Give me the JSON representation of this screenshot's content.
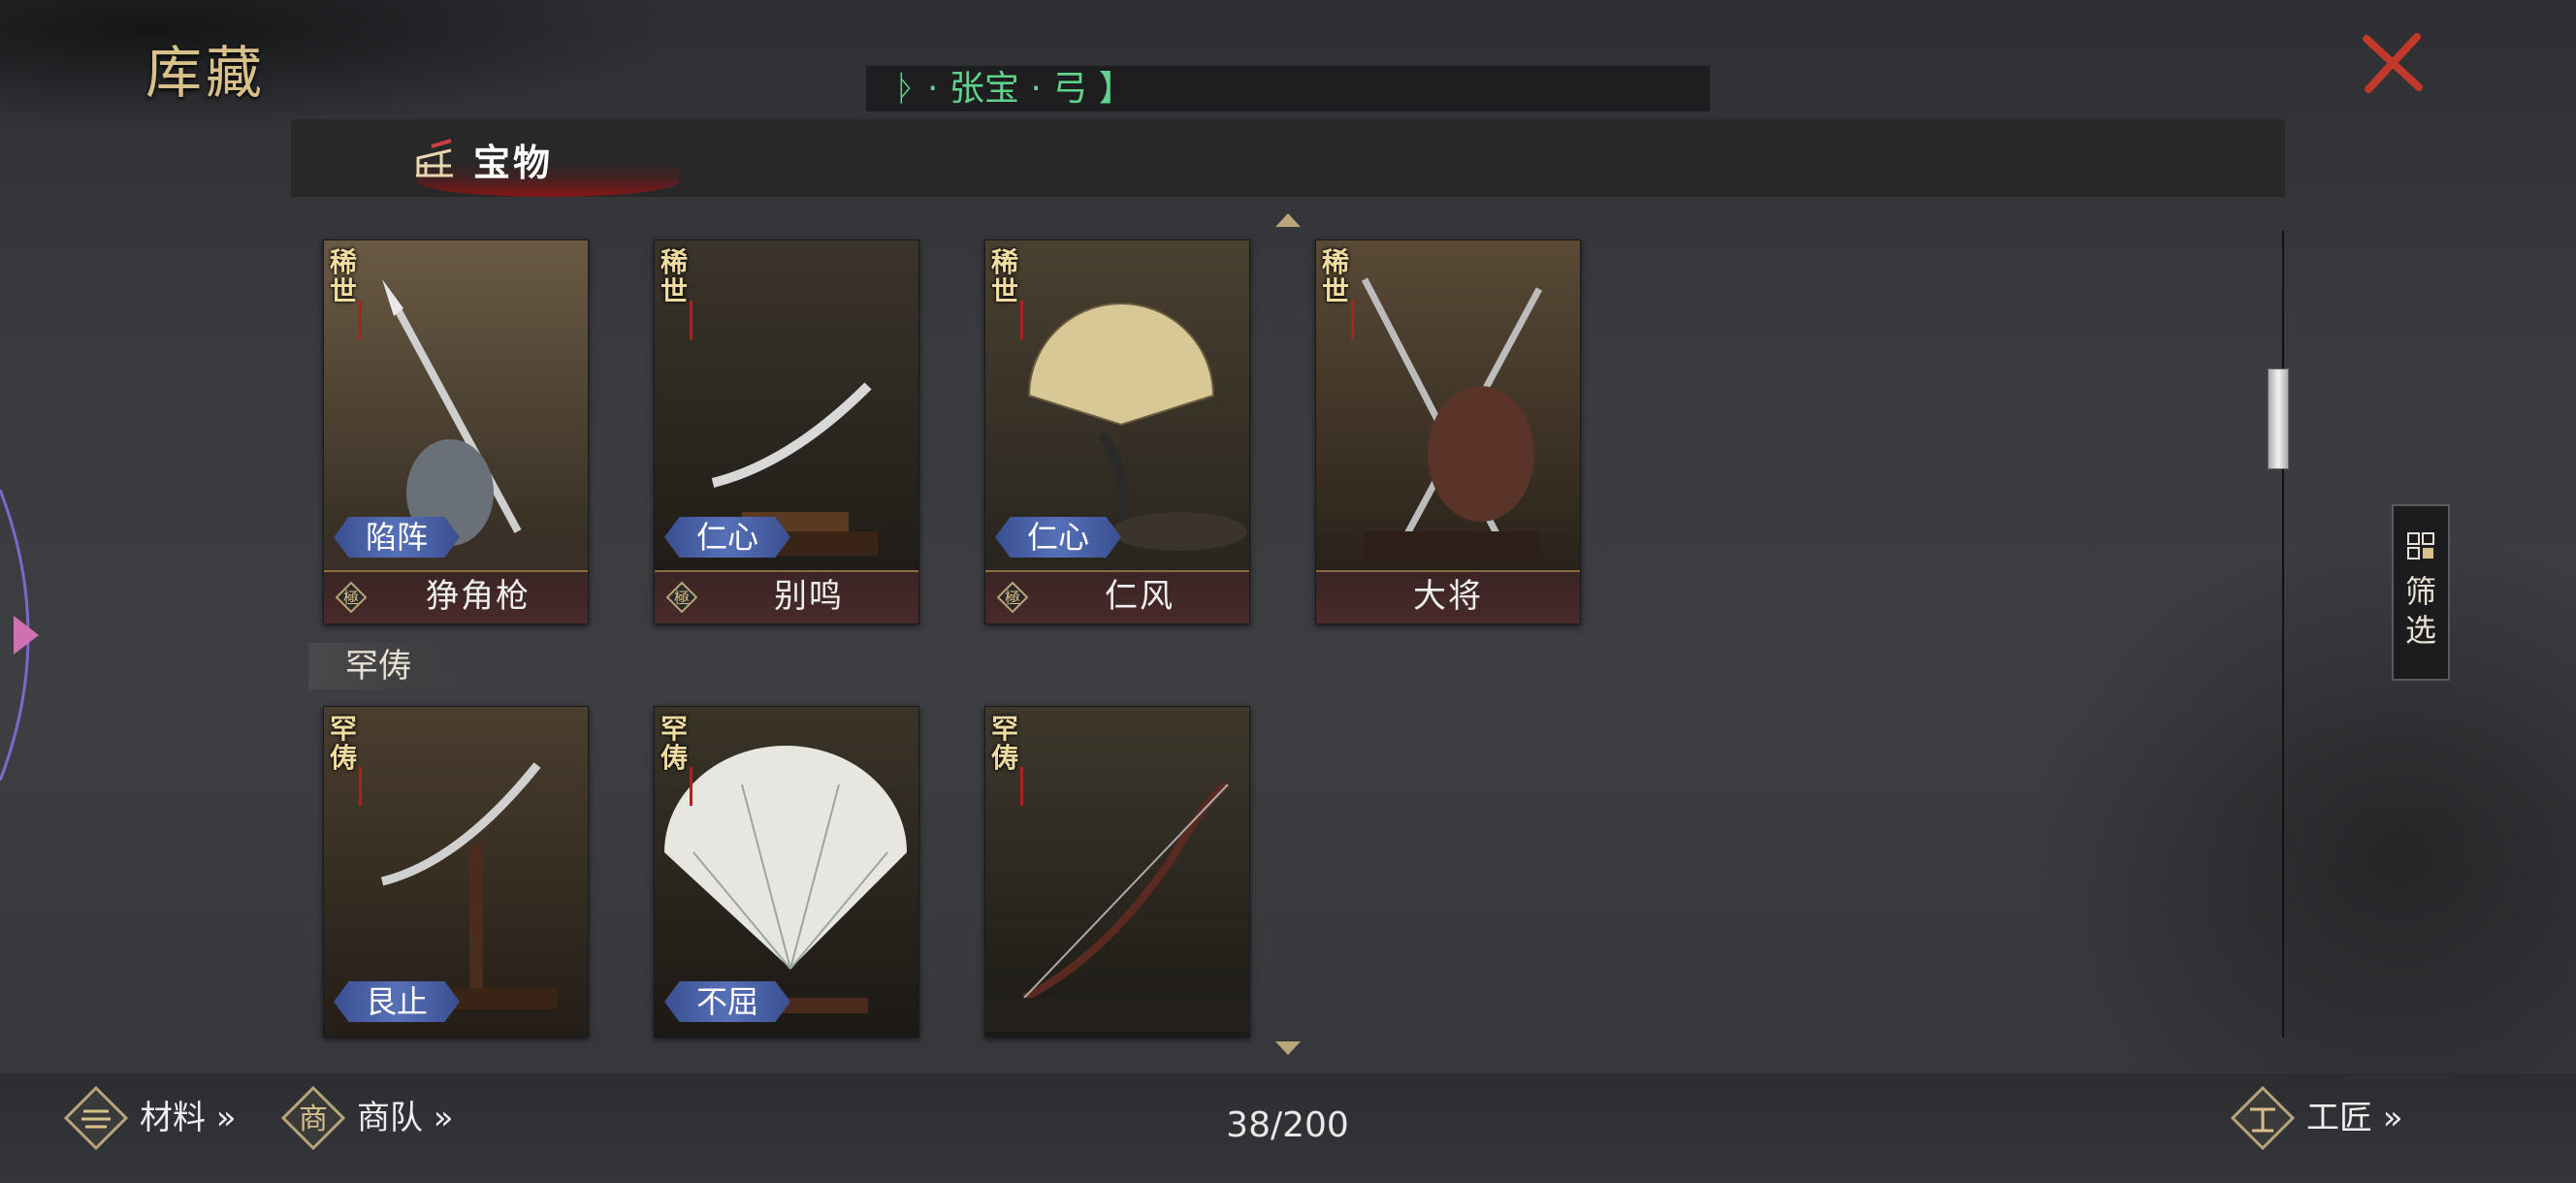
{
  "header": {
    "title": "库藏",
    "search_value": "ᚦ · 张宝 · 弓 】"
  },
  "tab": {
    "label": "宝物"
  },
  "section_rare": {
    "label": "罕俦"
  },
  "cards": [
    {
      "rarity": "稀世",
      "trait": "陷阵",
      "name": "狰角枪",
      "tier": "極"
    },
    {
      "rarity": "稀世",
      "trait": "仁心",
      "name": "别鸣",
      "tier": "極"
    },
    {
      "rarity": "稀世",
      "trait": "仁心",
      "name": "仁风",
      "tier": "極"
    },
    {
      "rarity": "稀世",
      "trait": "",
      "name": "大将",
      "tier": ""
    },
    {
      "rarity": "罕俦",
      "trait": "艮止",
      "name": "",
      "tier": ""
    },
    {
      "rarity": "罕俦",
      "trait": "不屈",
      "name": "",
      "tier": ""
    },
    {
      "rarity": "罕俦",
      "trait": "",
      "name": "",
      "tier": ""
    }
  ],
  "filter": {
    "label": "筛选"
  },
  "footer": {
    "materials": "材料 »",
    "caravan": "商队 »",
    "craftsman": "工匠 »",
    "count": "38/200"
  },
  "colors": {
    "gold": "#d8c08a",
    "search_text": "#5fd38a",
    "trait_blue": "#5670b8",
    "close_red": "#c0392b"
  }
}
